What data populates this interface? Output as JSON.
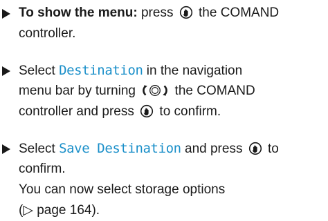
{
  "steps": [
    {
      "lines": [
        {
          "bold_lead": "To show the menu:",
          "text_a": " press",
          "text_b": " the COMAND"
        },
        {
          "text": "controller."
        }
      ]
    },
    {
      "lines": [
        {
          "text_a": "Select ",
          "ui": "Destination",
          "text_b": " in the navigation"
        },
        {
          "text_a": "menu bar by turning",
          "text_b": " the COMAND"
        },
        {
          "text_a": "controller and press",
          "text_b": " to confirm."
        }
      ]
    },
    {
      "lines": [
        {
          "text_a": "Select ",
          "ui": "Save Destination",
          "text_b": " and press",
          "text_c": " to"
        },
        {
          "text": "confirm."
        },
        {
          "text": "You can now select storage options"
        },
        {
          "text": "(▷ page 164)."
        }
      ]
    }
  ],
  "icons": {
    "press": "press-controller-icon",
    "turn": "turn-controller-icon"
  }
}
